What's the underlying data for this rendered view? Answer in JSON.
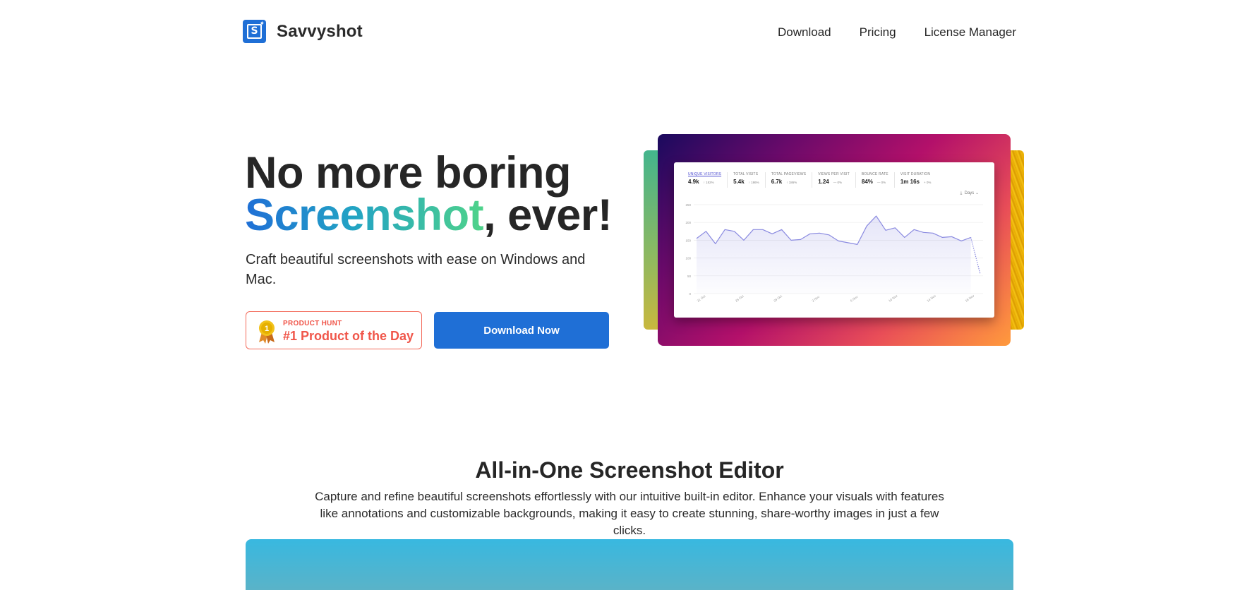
{
  "header": {
    "brand": "Savvyshot",
    "logo_letter": "S",
    "nav": [
      "Download",
      "Pricing",
      "License Manager"
    ]
  },
  "hero": {
    "title_line1": "No more boring",
    "title_highlight": "Screenshot",
    "title_rest": ", ever!",
    "subtitle": "Craft beautiful screenshots with ease on Windows and Mac.",
    "badge_small": "PRODUCT HUNT",
    "badge_big": "#1 Product of the Day",
    "badge_medal": "1",
    "cta": "Download Now"
  },
  "preview": {
    "metrics": [
      {
        "label": "UNIQUE VISITORS",
        "value": "4.9k",
        "delta": "↑ 182%"
      },
      {
        "label": "TOTAL VISITS",
        "value": "5.4k",
        "delta": "↑ 186%"
      },
      {
        "label": "TOTAL PAGEVIEWS",
        "value": "6.7k",
        "delta": "↑ 186%"
      },
      {
        "label": "VIEWS PER VISIT",
        "value": "1.24",
        "delta": "— 0%"
      },
      {
        "label": "BOUNCE RATE",
        "value": "84%",
        "delta": "— 0%"
      },
      {
        "label": "VISIT DURATION",
        "value": "1m 16s",
        "delta": "+ 0%"
      }
    ],
    "interval": "Days",
    "chart_data": {
      "type": "area",
      "yticks": [
        "250",
        "200",
        "150",
        "100",
        "50",
        "0"
      ],
      "ylim": [
        0,
        250
      ],
      "xticks": [
        "21 Oct",
        "25 Oct",
        "29 Oct",
        "2 Nov",
        "6 Nov",
        "10 Nov",
        "14 Nov",
        "18 Nov"
      ],
      "values": [
        155,
        175,
        140,
        180,
        175,
        150,
        180,
        180,
        168,
        180,
        150,
        152,
        168,
        170,
        165,
        148,
        143,
        138,
        190,
        218,
        178,
        185,
        158,
        180,
        172,
        170,
        158,
        160,
        148,
        158,
        55
      ],
      "color": "#8a8ae0"
    }
  },
  "features": {
    "title": "All-in-One Screenshot Editor",
    "description": "Capture and refine beautiful screenshots effortlessly with our intuitive built-in editor. Enhance your visuals with features like annotations and customizable backgrounds, making it easy to create stunning, share-worthy images in just a few clicks."
  }
}
